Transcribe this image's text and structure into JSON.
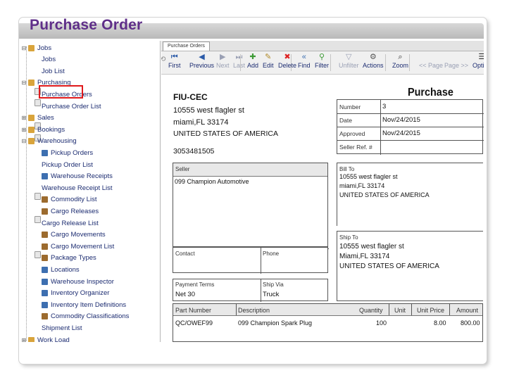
{
  "slide": {
    "title": "Purchase Order"
  },
  "tree": {
    "items": [
      {
        "label": "Jobs",
        "icon": "folder-icon"
      },
      {
        "label": "Jobs",
        "icon": "document-icon"
      },
      {
        "label": "Job List",
        "icon": "document-icon"
      },
      {
        "label": "Purchasing",
        "icon": "folder-icon"
      },
      {
        "label": "Purchase Orders",
        "icon": "document-icon",
        "selected": true
      },
      {
        "label": "Purchase Order List",
        "icon": "document-icon"
      },
      {
        "label": "Sales",
        "icon": "folder-icon"
      },
      {
        "label": "Bookings",
        "icon": "folder-icon"
      },
      {
        "label": "Warehousing",
        "icon": "folder-icon"
      },
      {
        "label": "Pickup Orders",
        "icon": "pickup-icon"
      },
      {
        "label": "Pickup Order List",
        "icon": "document-icon"
      },
      {
        "label": "Warehouse Receipts",
        "icon": "receipt-icon"
      },
      {
        "label": "Warehouse Receipt List",
        "icon": "document-icon"
      },
      {
        "label": "Commodity List",
        "icon": "commodity-icon"
      },
      {
        "label": "Cargo Releases",
        "icon": "cargo-icon"
      },
      {
        "label": "Cargo Release List",
        "icon": "document-icon"
      },
      {
        "label": "Cargo Movements",
        "icon": "cargo-icon"
      },
      {
        "label": "Cargo Movement List",
        "icon": "cargo-icon"
      },
      {
        "label": "Package Types",
        "icon": "package-icon"
      },
      {
        "label": "Locations",
        "icon": "location-icon"
      },
      {
        "label": "Warehouse Inspector",
        "icon": "inspector-icon"
      },
      {
        "label": "Inventory Organizer",
        "icon": "inventory-icon"
      },
      {
        "label": "Inventory Item Definitions",
        "icon": "inventory-icon"
      },
      {
        "label": "Commodity Classifications",
        "icon": "commodity-icon"
      },
      {
        "label": "Shipment List",
        "icon": "document-icon"
      },
      {
        "label": "Work Load",
        "icon": "folder-icon"
      }
    ]
  },
  "tab": {
    "label": "Purchase Orders"
  },
  "toolbar": {
    "buttons": [
      {
        "label": "First",
        "icon": "first-icon"
      },
      {
        "label": "Previous",
        "icon": "previous-icon"
      },
      {
        "label": "Next",
        "icon": "next-icon",
        "disabled": true
      },
      {
        "label": "Last",
        "icon": "last-icon",
        "disabled": true
      },
      {
        "label": "Add",
        "icon": "add-icon"
      },
      {
        "label": "Edit",
        "icon": "edit-icon"
      },
      {
        "label": "Delete",
        "icon": "delete-icon"
      },
      {
        "label": "Find",
        "icon": "find-icon"
      },
      {
        "label": "Filter",
        "icon": "filter-icon"
      },
      {
        "label": "Unfilter",
        "icon": "unfilter-icon",
        "disabled": true
      },
      {
        "label": "Actions",
        "icon": "actions-icon"
      },
      {
        "label": "Zoom",
        "icon": "zoom-icon"
      },
      {
        "label": "<< Page",
        "icon": "",
        "disabled": true
      },
      {
        "label": "Page >>",
        "icon": "",
        "disabled": true
      },
      {
        "label": "Option",
        "icon": "option-icon"
      }
    ]
  },
  "document": {
    "title": "Purchase Order",
    "company": {
      "name": "FIU-CEC",
      "address1": "10555 west flagler st",
      "address2": "miami,FL 33174",
      "country": "UNITED STATES OF AMERICA",
      "phone": "3053481505"
    },
    "meta": [
      {
        "label": "Number",
        "value": "3"
      },
      {
        "label": "Date",
        "value": "Nov/24/2015"
      },
      {
        "label": "Approved",
        "value": "Nov/24/2015"
      },
      {
        "label": "Seller Ref. #",
        "value": ""
      }
    ],
    "seller": {
      "label": "Seller",
      "value": "099 Champion Automotive"
    },
    "bill_to": {
      "label": "Bill To",
      "address1": "10555 west flagler st",
      "address2": "miami,FL 33174",
      "country": "UNITED STATES OF AMERICA"
    },
    "ship_to": {
      "label": "Ship To",
      "address1": "10555 west flagler st",
      "address2": "Miami,FL 33174",
      "country": "UNITED STATES OF AMERICA"
    },
    "contact": {
      "label": "Contact",
      "value": ""
    },
    "phone": {
      "label": "Phone",
      "value": ""
    },
    "payment_terms": {
      "label": "Payment Terms",
      "value": "Net 30"
    },
    "ship_via": {
      "label": "Ship Via",
      "value": "Truck"
    },
    "items_table": {
      "headers": [
        "Part Number",
        "Description",
        "Quantity",
        "Unit",
        "Unit Price",
        "Amount"
      ],
      "rows": [
        [
          "QC/OWEF99",
          "099 Champion Spark Plug",
          "100",
          "",
          "8.00",
          "800.00"
        ]
      ]
    }
  }
}
